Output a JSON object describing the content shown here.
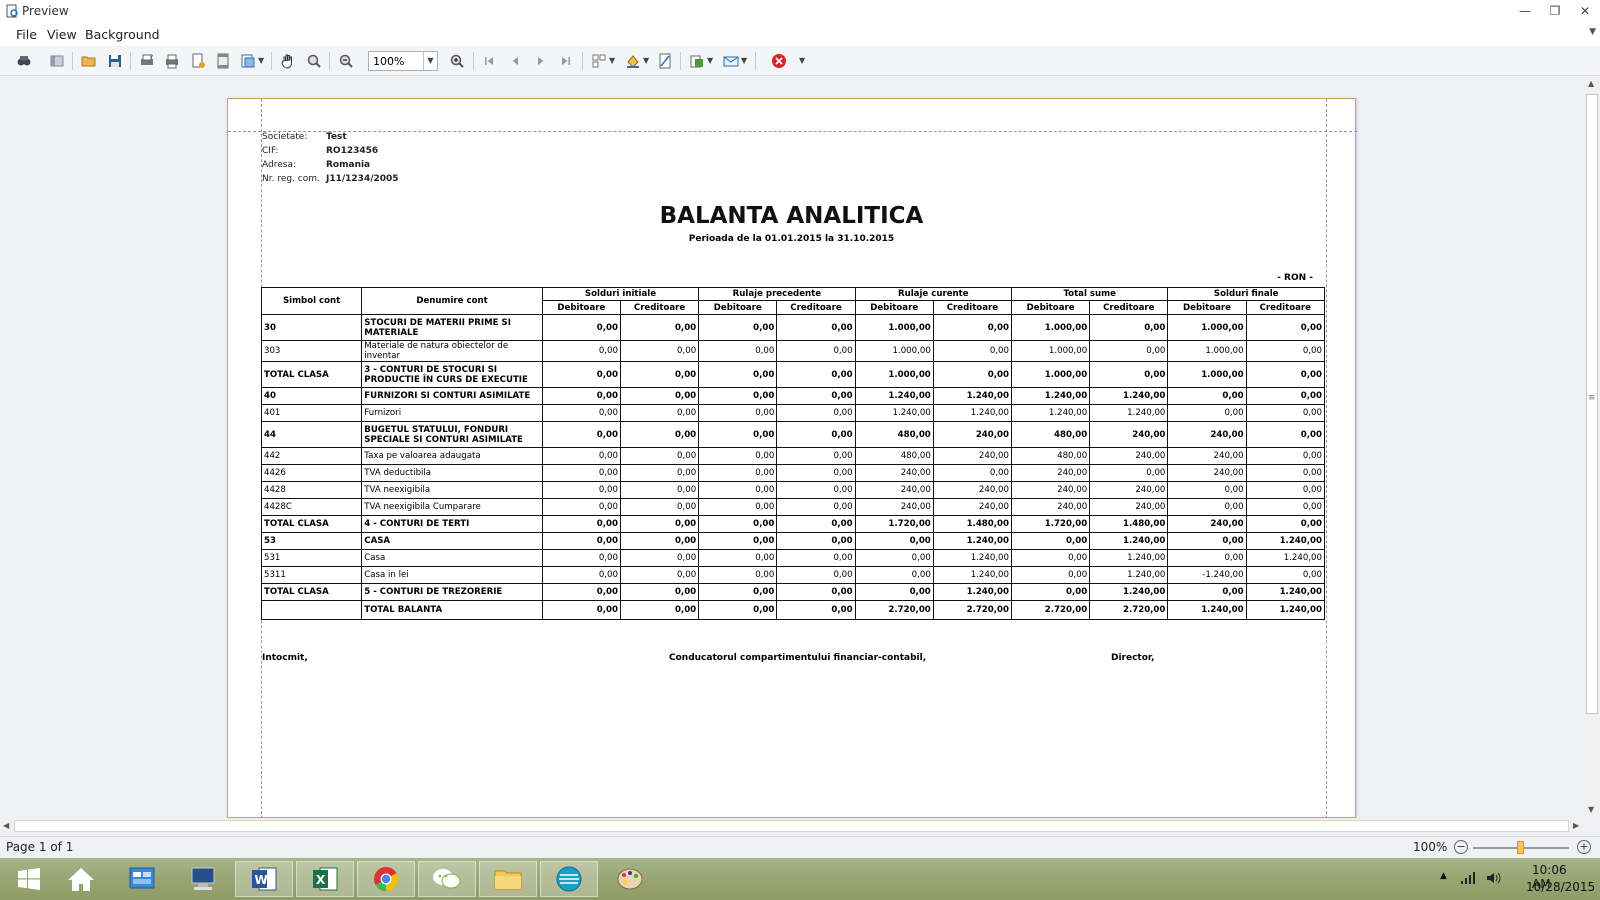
{
  "window": {
    "title": "Preview"
  },
  "menu": {
    "items": [
      "File",
      "View",
      "Background"
    ]
  },
  "toolbar": {
    "zoom": "100%"
  },
  "report": {
    "company": {
      "label": "Societate:",
      "value": "Test"
    },
    "cif": {
      "label": "CIF:",
      "value": "RO123456"
    },
    "address": {
      "label": "Adresa:",
      "value": "Romania"
    },
    "reg": {
      "label": "Nr. reg. com.",
      "value": "J11/1234/2005"
    },
    "title": "BALANTA ANALITICA",
    "period": "Perioada de la 01.01.2015 la 31.10.2015",
    "currency": "- RON -",
    "columns": {
      "symbol": "Simbol cont",
      "name": "Denumire cont",
      "groups": [
        "Solduri initiale",
        "Rulaje precedente",
        "Rulaje curente",
        "Total sume",
        "Solduri finale"
      ],
      "debit": "Debitoare",
      "credit": "Creditoare"
    },
    "rows": [
      {
        "sym": "30",
        "name": "STOCURI DE MATERII PRIME SI MATERIALE",
        "bold": true,
        "two": true,
        "v": [
          "0,00",
          "0,00",
          "0,00",
          "0,00",
          "1.000,00",
          "0,00",
          "1.000,00",
          "0,00",
          "1.000,00",
          "0,00"
        ]
      },
      {
        "sym": "303",
        "name": "Materiale de natura obiectelor de inventar",
        "bold": false,
        "two": false,
        "v": [
          "0,00",
          "0,00",
          "0,00",
          "0,00",
          "1.000,00",
          "0,00",
          "1.000,00",
          "0,00",
          "1.000,00",
          "0,00"
        ]
      },
      {
        "sym": "TOTAL CLASA",
        "name": "3 - CONTURI DE STOCURI SI PRODUCTIE ÎN CURS DE EXECUTIE",
        "bold": true,
        "two": true,
        "v": [
          "0,00",
          "0,00",
          "0,00",
          "0,00",
          "1.000,00",
          "0,00",
          "1.000,00",
          "0,00",
          "1.000,00",
          "0,00"
        ]
      },
      {
        "sym": "40",
        "name": "FURNIZORI SI CONTURI ASIMILATE",
        "bold": true,
        "two": false,
        "v": [
          "0,00",
          "0,00",
          "0,00",
          "0,00",
          "1.240,00",
          "1.240,00",
          "1.240,00",
          "1.240,00",
          "0,00",
          "0,00"
        ]
      },
      {
        "sym": "401",
        "name": "Furnizori",
        "bold": false,
        "two": false,
        "v": [
          "0,00",
          "0,00",
          "0,00",
          "0,00",
          "1.240,00",
          "1.240,00",
          "1.240,00",
          "1.240,00",
          "0,00",
          "0,00"
        ]
      },
      {
        "sym": "44",
        "name": "BUGETUL STATULUI, FONDURI SPECIALE SI CONTURI ASIMILATE",
        "bold": true,
        "two": true,
        "v": [
          "0,00",
          "0,00",
          "0,00",
          "0,00",
          "480,00",
          "240,00",
          "480,00",
          "240,00",
          "240,00",
          "0,00"
        ]
      },
      {
        "sym": "442",
        "name": "Taxa pe valoarea adaugata",
        "bold": false,
        "two": false,
        "v": [
          "0,00",
          "0,00",
          "0,00",
          "0,00",
          "480,00",
          "240,00",
          "480,00",
          "240,00",
          "240,00",
          "0,00"
        ]
      },
      {
        "sym": "4426",
        "name": "TVA deductibila",
        "bold": false,
        "two": false,
        "v": [
          "0,00",
          "0,00",
          "0,00",
          "0,00",
          "240,00",
          "0,00",
          "240,00",
          "0,00",
          "240,00",
          "0,00"
        ]
      },
      {
        "sym": "4428",
        "name": "TVA neexigibila",
        "bold": false,
        "two": false,
        "v": [
          "0,00",
          "0,00",
          "0,00",
          "0,00",
          "240,00",
          "240,00",
          "240,00",
          "240,00",
          "0,00",
          "0,00"
        ]
      },
      {
        "sym": "4428C",
        "name": "TVA neexigibila Cumparare",
        "bold": false,
        "two": false,
        "v": [
          "0,00",
          "0,00",
          "0,00",
          "0,00",
          "240,00",
          "240,00",
          "240,00",
          "240,00",
          "0,00",
          "0,00"
        ]
      },
      {
        "sym": "TOTAL CLASA",
        "name": "4 - CONTURI DE TERTI",
        "bold": true,
        "two": false,
        "v": [
          "0,00",
          "0,00",
          "0,00",
          "0,00",
          "1.720,00",
          "1.480,00",
          "1.720,00",
          "1.480,00",
          "240,00",
          "0,00"
        ]
      },
      {
        "sym": "53",
        "name": "CASA",
        "bold": true,
        "two": false,
        "v": [
          "0,00",
          "0,00",
          "0,00",
          "0,00",
          "0,00",
          "1.240,00",
          "0,00",
          "1.240,00",
          "0,00",
          "1.240,00"
        ]
      },
      {
        "sym": "531",
        "name": "Casa",
        "bold": false,
        "two": false,
        "v": [
          "0,00",
          "0,00",
          "0,00",
          "0,00",
          "0,00",
          "1.240,00",
          "0,00",
          "1.240,00",
          "0,00",
          "1.240,00"
        ]
      },
      {
        "sym": "5311",
        "name": "Casa in lei",
        "bold": false,
        "two": false,
        "v": [
          "0,00",
          "0,00",
          "0,00",
          "0,00",
          "0,00",
          "1.240,00",
          "0,00",
          "1.240,00",
          "-1.240,00",
          "0,00"
        ]
      },
      {
        "sym": "TOTAL CLASA",
        "name": "5 - CONTURI DE TREZORERIE",
        "bold": true,
        "two": false,
        "v": [
          "0,00",
          "0,00",
          "0,00",
          "0,00",
          "0,00",
          "1.240,00",
          "0,00",
          "1.240,00",
          "0,00",
          "1.240,00"
        ]
      }
    ],
    "total": {
      "label": "TOTAL BALANTA",
      "v": [
        "0,00",
        "0,00",
        "0,00",
        "0,00",
        "2.720,00",
        "2.720,00",
        "2.720,00",
        "2.720,00",
        "1.240,00",
        "1.240,00"
      ]
    },
    "signatures": [
      "Intocmit,",
      "Conducatorul compartimentului financiar-contabil,",
      "Director,"
    ]
  },
  "status": {
    "page": "Page 1 of 1",
    "zoom": "100%",
    "zoom_fraction": 0.5
  },
  "tray": {
    "time": "10:06 AM",
    "date": "10/28/2015"
  },
  "taskbar_icons": [
    "windows-start-icon",
    "home-icon",
    "control-panel-icon",
    "computer-icon",
    "word-icon",
    "excel-icon",
    "chrome-icon",
    "wechat-icon",
    "file-explorer-icon",
    "app-icon",
    "paint-icon"
  ]
}
